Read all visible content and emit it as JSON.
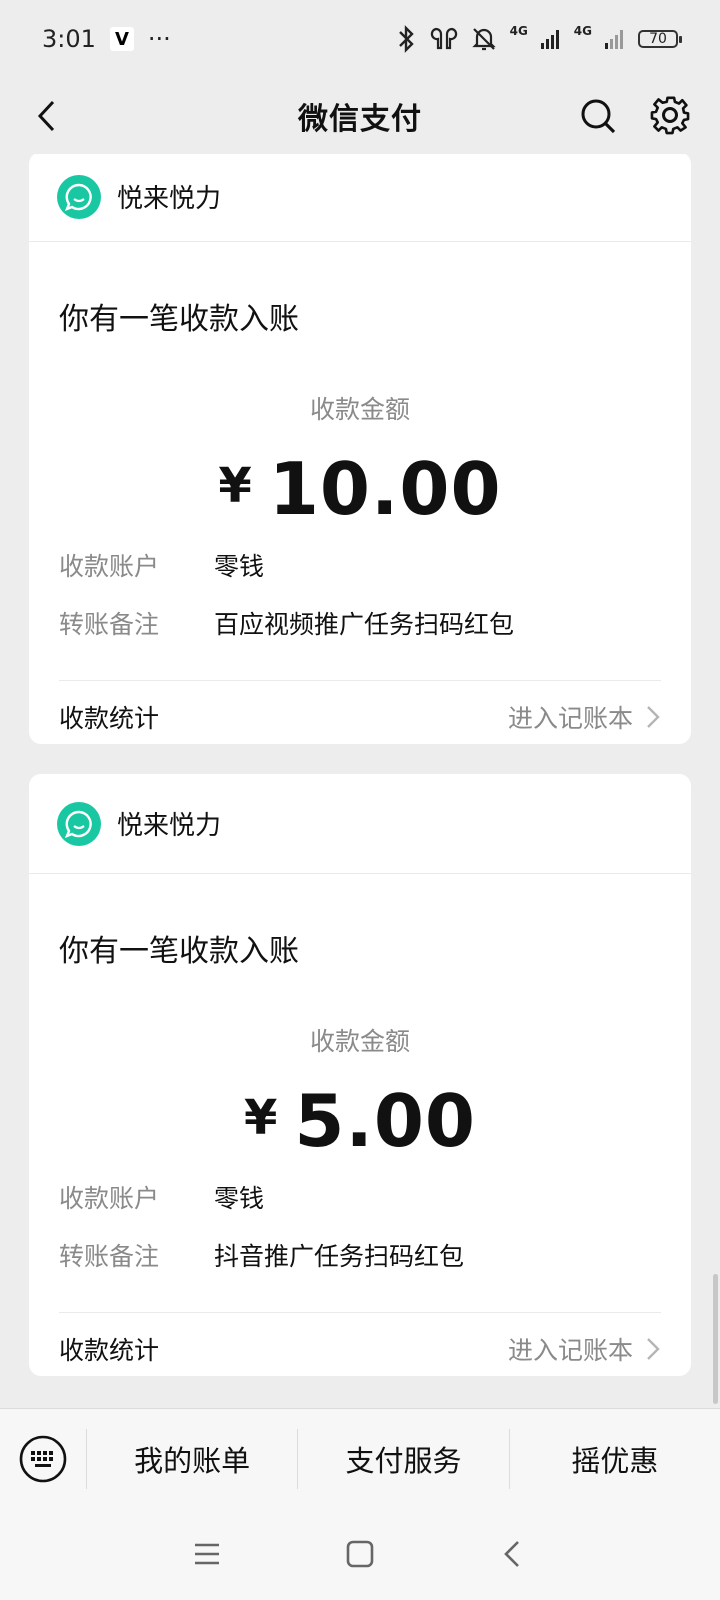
{
  "status_bar": {
    "time": "3:01",
    "badge": "V",
    "dots": "···",
    "network_1": "4G",
    "network_2": "4G",
    "battery": "70"
  },
  "nav": {
    "title": "微信支付"
  },
  "cards": [
    {
      "merchant": "悦来悦力",
      "message": "你有一笔收款入账",
      "amount_label": "收款金额",
      "currency": "¥",
      "amount": "10.00",
      "account_key": "收款账户",
      "account_value": "零钱",
      "note_key": "转账备注",
      "note_value": "百应视频推广任务扫码红包",
      "stats_label": "收款统计",
      "stats_link": "进入记账本"
    },
    {
      "merchant": "悦来悦力",
      "message": "你有一笔收款入账",
      "amount_label": "收款金额",
      "currency": "¥",
      "amount": "5.00",
      "account_key": "收款账户",
      "account_value": "零钱",
      "note_key": "转账备注",
      "note_value": "抖音推广任务扫码红包",
      "stats_label": "收款统计",
      "stats_link": "进入记账本"
    }
  ],
  "bottom_menu": {
    "items": [
      "我的账单",
      "支付服务",
      "摇优惠"
    ]
  },
  "colors": {
    "avatar": "#19c8a2",
    "background": "#ededed"
  },
  "icons": [
    "back-arrow-icon",
    "search-icon",
    "gear-icon",
    "chat-bubble-icon",
    "chevron-right-icon",
    "keyboard-icon",
    "menu-icon",
    "home-square-icon",
    "back-icon"
  ]
}
